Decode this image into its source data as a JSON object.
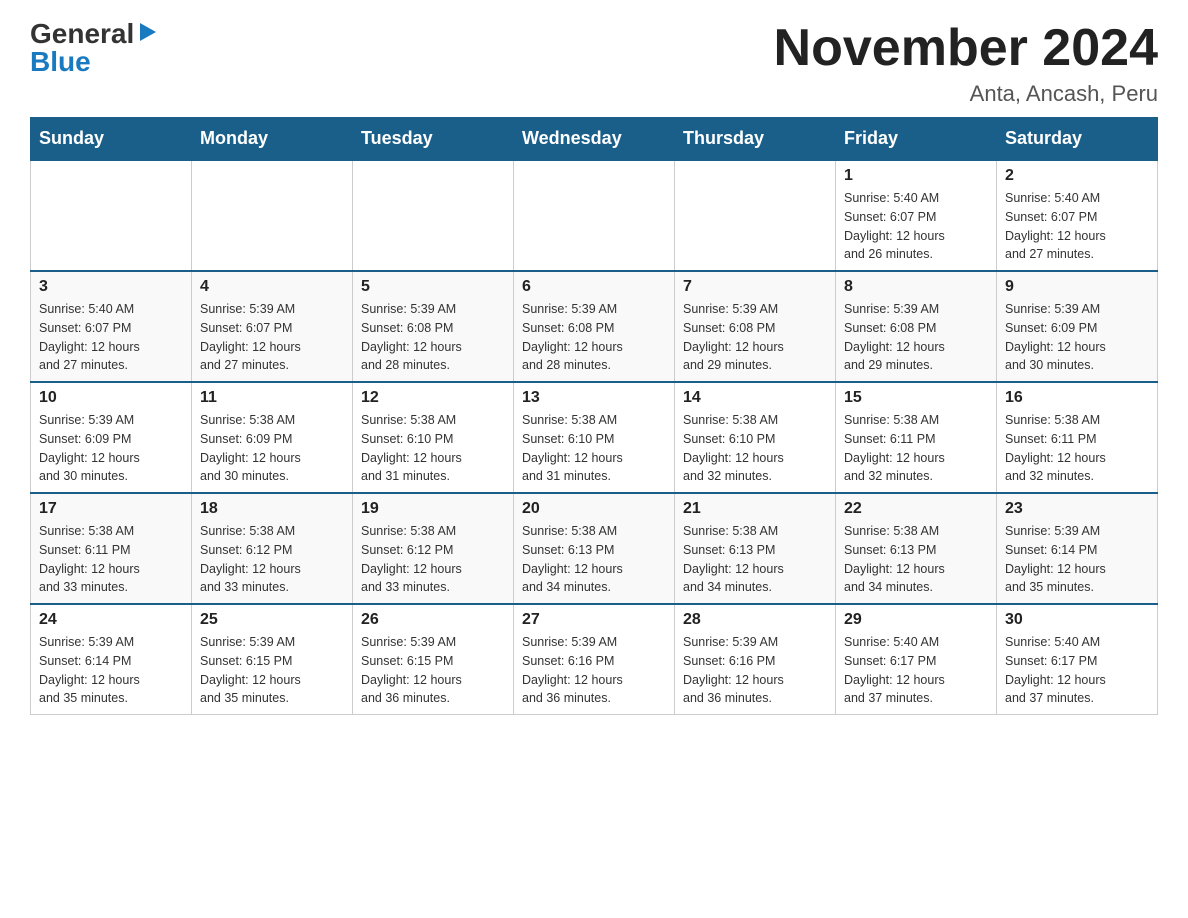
{
  "logo": {
    "general": "General",
    "blue": "Blue",
    "triangle": "▶"
  },
  "title": "November 2024",
  "subtitle": "Anta, Ancash, Peru",
  "days_of_week": [
    "Sunday",
    "Monday",
    "Tuesday",
    "Wednesday",
    "Thursday",
    "Friday",
    "Saturday"
  ],
  "weeks": [
    [
      {
        "day": "",
        "info": ""
      },
      {
        "day": "",
        "info": ""
      },
      {
        "day": "",
        "info": ""
      },
      {
        "day": "",
        "info": ""
      },
      {
        "day": "",
        "info": ""
      },
      {
        "day": "1",
        "info": "Sunrise: 5:40 AM\nSunset: 6:07 PM\nDaylight: 12 hours\nand 26 minutes."
      },
      {
        "day": "2",
        "info": "Sunrise: 5:40 AM\nSunset: 6:07 PM\nDaylight: 12 hours\nand 27 minutes."
      }
    ],
    [
      {
        "day": "3",
        "info": "Sunrise: 5:40 AM\nSunset: 6:07 PM\nDaylight: 12 hours\nand 27 minutes."
      },
      {
        "day": "4",
        "info": "Sunrise: 5:39 AM\nSunset: 6:07 PM\nDaylight: 12 hours\nand 27 minutes."
      },
      {
        "day": "5",
        "info": "Sunrise: 5:39 AM\nSunset: 6:08 PM\nDaylight: 12 hours\nand 28 minutes."
      },
      {
        "day": "6",
        "info": "Sunrise: 5:39 AM\nSunset: 6:08 PM\nDaylight: 12 hours\nand 28 minutes."
      },
      {
        "day": "7",
        "info": "Sunrise: 5:39 AM\nSunset: 6:08 PM\nDaylight: 12 hours\nand 29 minutes."
      },
      {
        "day": "8",
        "info": "Sunrise: 5:39 AM\nSunset: 6:08 PM\nDaylight: 12 hours\nand 29 minutes."
      },
      {
        "day": "9",
        "info": "Sunrise: 5:39 AM\nSunset: 6:09 PM\nDaylight: 12 hours\nand 30 minutes."
      }
    ],
    [
      {
        "day": "10",
        "info": "Sunrise: 5:39 AM\nSunset: 6:09 PM\nDaylight: 12 hours\nand 30 minutes."
      },
      {
        "day": "11",
        "info": "Sunrise: 5:38 AM\nSunset: 6:09 PM\nDaylight: 12 hours\nand 30 minutes."
      },
      {
        "day": "12",
        "info": "Sunrise: 5:38 AM\nSunset: 6:10 PM\nDaylight: 12 hours\nand 31 minutes."
      },
      {
        "day": "13",
        "info": "Sunrise: 5:38 AM\nSunset: 6:10 PM\nDaylight: 12 hours\nand 31 minutes."
      },
      {
        "day": "14",
        "info": "Sunrise: 5:38 AM\nSunset: 6:10 PM\nDaylight: 12 hours\nand 32 minutes."
      },
      {
        "day": "15",
        "info": "Sunrise: 5:38 AM\nSunset: 6:11 PM\nDaylight: 12 hours\nand 32 minutes."
      },
      {
        "day": "16",
        "info": "Sunrise: 5:38 AM\nSunset: 6:11 PM\nDaylight: 12 hours\nand 32 minutes."
      }
    ],
    [
      {
        "day": "17",
        "info": "Sunrise: 5:38 AM\nSunset: 6:11 PM\nDaylight: 12 hours\nand 33 minutes."
      },
      {
        "day": "18",
        "info": "Sunrise: 5:38 AM\nSunset: 6:12 PM\nDaylight: 12 hours\nand 33 minutes."
      },
      {
        "day": "19",
        "info": "Sunrise: 5:38 AM\nSunset: 6:12 PM\nDaylight: 12 hours\nand 33 minutes."
      },
      {
        "day": "20",
        "info": "Sunrise: 5:38 AM\nSunset: 6:13 PM\nDaylight: 12 hours\nand 34 minutes."
      },
      {
        "day": "21",
        "info": "Sunrise: 5:38 AM\nSunset: 6:13 PM\nDaylight: 12 hours\nand 34 minutes."
      },
      {
        "day": "22",
        "info": "Sunrise: 5:38 AM\nSunset: 6:13 PM\nDaylight: 12 hours\nand 34 minutes."
      },
      {
        "day": "23",
        "info": "Sunrise: 5:39 AM\nSunset: 6:14 PM\nDaylight: 12 hours\nand 35 minutes."
      }
    ],
    [
      {
        "day": "24",
        "info": "Sunrise: 5:39 AM\nSunset: 6:14 PM\nDaylight: 12 hours\nand 35 minutes."
      },
      {
        "day": "25",
        "info": "Sunrise: 5:39 AM\nSunset: 6:15 PM\nDaylight: 12 hours\nand 35 minutes."
      },
      {
        "day": "26",
        "info": "Sunrise: 5:39 AM\nSunset: 6:15 PM\nDaylight: 12 hours\nand 36 minutes."
      },
      {
        "day": "27",
        "info": "Sunrise: 5:39 AM\nSunset: 6:16 PM\nDaylight: 12 hours\nand 36 minutes."
      },
      {
        "day": "28",
        "info": "Sunrise: 5:39 AM\nSunset: 6:16 PM\nDaylight: 12 hours\nand 36 minutes."
      },
      {
        "day": "29",
        "info": "Sunrise: 5:40 AM\nSunset: 6:17 PM\nDaylight: 12 hours\nand 37 minutes."
      },
      {
        "day": "30",
        "info": "Sunrise: 5:40 AM\nSunset: 6:17 PM\nDaylight: 12 hours\nand 37 minutes."
      }
    ]
  ]
}
